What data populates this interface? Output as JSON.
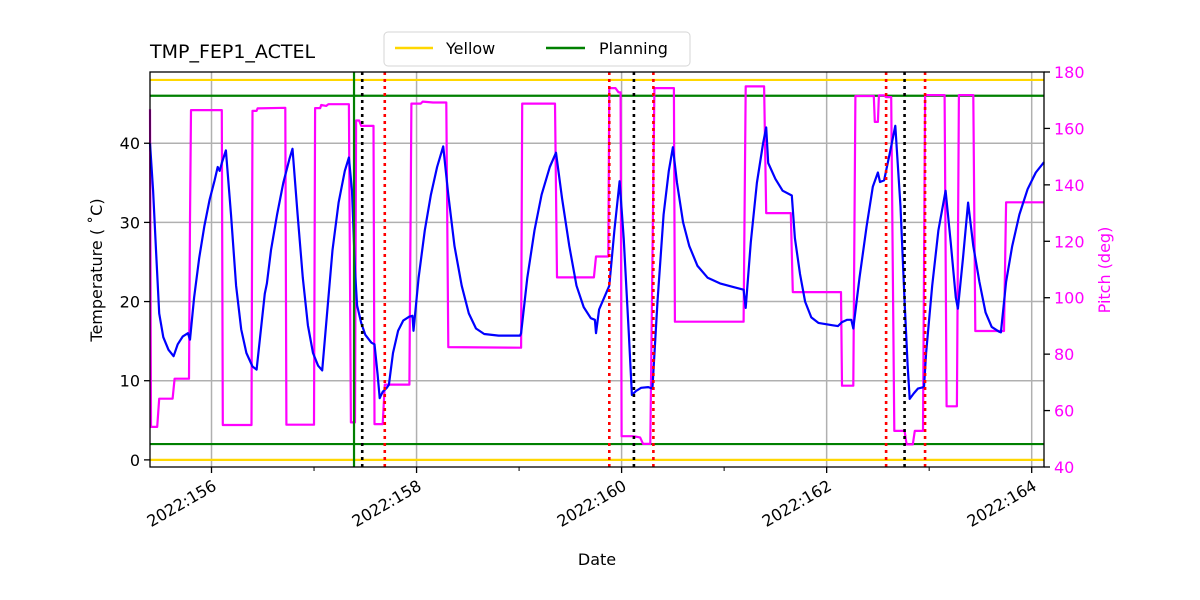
{
  "chart_data": {
    "type": "line",
    "title": "TMP_FEP1_ACTEL",
    "xlabel": "Date",
    "ylabel": "Temperature ($^\\circ$C)",
    "ylabel_display": "Temperature ( ˚C)",
    "y2label": "Pitch (deg)",
    "xlim": [
      155.4,
      164.12
    ],
    "ylim": [
      -0.9,
      49
    ],
    "y2lim": [
      40,
      180
    ],
    "x_ticks": [
      156,
      158,
      160,
      162,
      164
    ],
    "x_tick_labels": [
      "2022:156",
      "2022:158",
      "2022:160",
      "2022:162",
      "2022:164"
    ],
    "x_minor_ticks": [
      157,
      159,
      161,
      163
    ],
    "y_ticks": [
      0,
      10,
      20,
      30,
      40
    ],
    "y_tick_labels": [
      "0",
      "10",
      "20",
      "30",
      "40"
    ],
    "y2_ticks": [
      40,
      60,
      80,
      100,
      120,
      140,
      160,
      180
    ],
    "y2_tick_labels": [
      "40",
      "60",
      "80",
      "100",
      "120",
      "140",
      "160",
      "180"
    ],
    "grid": true,
    "legend": {
      "placement": "top-center",
      "entries": [
        {
          "label": "Yellow",
          "color": "#ffd700"
        },
        {
          "label": "Planning",
          "color": "#008000"
        }
      ]
    },
    "colors": {
      "temperature": "#0000ff",
      "pitch": "#ff00ff",
      "yellow": "#ffd700",
      "planning": "#008000",
      "grid": "#b0b0b0",
      "pitch_axis": "#ff00ff",
      "marker_black": "#000000",
      "marker_red": "#ff0000",
      "now_line": "#008000"
    },
    "hlines": [
      {
        "name": "yellow-high",
        "y": 48,
        "color": "#ffd700",
        "axis": "temperature"
      },
      {
        "name": "planning-high",
        "y": 46,
        "color": "#008000",
        "axis": "temperature"
      },
      {
        "name": "planning-low",
        "y": 2,
        "color": "#008000",
        "axis": "temperature"
      },
      {
        "name": "yellow-low",
        "y": 0,
        "color": "#ffd700",
        "axis": "temperature"
      }
    ],
    "vlines": [
      {
        "name": "now-line",
        "x": 157.39,
        "style": "solid",
        "color": "#008000"
      },
      {
        "name": "black-marker-1",
        "x": 157.47,
        "style": "dotted",
        "color": "#000000"
      },
      {
        "name": "red-marker-1",
        "x": 157.69,
        "style": "dotted",
        "color": "#ff0000"
      },
      {
        "name": "red-marker-2",
        "x": 159.88,
        "style": "dotted",
        "color": "#ff0000"
      },
      {
        "name": "black-marker-2",
        "x": 160.12,
        "style": "dotted",
        "color": "#000000"
      },
      {
        "name": "red-marker-3",
        "x": 160.31,
        "style": "dotted",
        "color": "#ff0000"
      },
      {
        "name": "red-marker-4",
        "x": 162.58,
        "style": "dotted",
        "color": "#ff0000"
      },
      {
        "name": "black-marker-3",
        "x": 162.76,
        "style": "dotted",
        "color": "#000000"
      },
      {
        "name": "red-marker-5",
        "x": 162.96,
        "style": "dotted",
        "color": "#ff0000"
      }
    ],
    "series": [
      {
        "name": "Temperature",
        "axis": "temperature",
        "color": "#0000ff",
        "points": [
          [
            155.4,
            40.0
          ],
          [
            155.43,
            34.0
          ],
          [
            155.46,
            26.0
          ],
          [
            155.49,
            18.5
          ],
          [
            155.53,
            15.5
          ],
          [
            155.58,
            13.9
          ],
          [
            155.63,
            13.1
          ],
          [
            155.67,
            14.6
          ],
          [
            155.72,
            15.6
          ],
          [
            155.77,
            16.0
          ],
          [
            155.79,
            15.2
          ],
          [
            155.83,
            20.5
          ],
          [
            155.88,
            25.5
          ],
          [
            155.93,
            29.5
          ],
          [
            155.98,
            32.8
          ],
          [
            156.03,
            35.3
          ],
          [
            156.06,
            37.0
          ],
          [
            156.08,
            36.5
          ],
          [
            156.1,
            37.5
          ],
          [
            156.14,
            39.1
          ],
          [
            156.19,
            31.0
          ],
          [
            156.24,
            22.0
          ],
          [
            156.29,
            16.5
          ],
          [
            156.34,
            13.5
          ],
          [
            156.4,
            11.8
          ],
          [
            156.44,
            11.4
          ],
          [
            156.49,
            17.5
          ],
          [
            156.52,
            21.0
          ],
          [
            156.54,
            22.3
          ],
          [
            156.58,
            26.5
          ],
          [
            156.64,
            31.0
          ],
          [
            156.7,
            35.0
          ],
          [
            156.76,
            38.0
          ],
          [
            156.79,
            39.3
          ],
          [
            156.84,
            31.0
          ],
          [
            156.89,
            23.0
          ],
          [
            156.94,
            17.0
          ],
          [
            156.99,
            13.5
          ],
          [
            157.04,
            11.9
          ],
          [
            157.08,
            11.3
          ],
          [
            157.13,
            19.0
          ],
          [
            157.18,
            26.5
          ],
          [
            157.24,
            32.5
          ],
          [
            157.3,
            36.5
          ],
          [
            157.34,
            38.2
          ],
          [
            157.37,
            34.0
          ],
          [
            157.4,
            24.0
          ],
          [
            157.42,
            19.5
          ],
          [
            157.46,
            17.3
          ],
          [
            157.5,
            15.8
          ],
          [
            157.56,
            14.8
          ],
          [
            157.59,
            14.6
          ],
          [
            157.62,
            10.8
          ],
          [
            157.64,
            7.8
          ],
          [
            157.67,
            8.6
          ],
          [
            157.71,
            9.1
          ],
          [
            157.73,
            9.5
          ],
          [
            157.77,
            13.5
          ],
          [
            157.82,
            16.3
          ],
          [
            157.87,
            17.6
          ],
          [
            157.93,
            18.1
          ],
          [
            157.96,
            18.2
          ],
          [
            157.97,
            16.3
          ],
          [
            158.02,
            23.0
          ],
          [
            158.08,
            29.0
          ],
          [
            158.14,
            33.5
          ],
          [
            158.2,
            37.0
          ],
          [
            158.26,
            39.6
          ],
          [
            158.31,
            33.5
          ],
          [
            158.37,
            27.0
          ],
          [
            158.44,
            22.0
          ],
          [
            158.51,
            18.5
          ],
          [
            158.58,
            16.6
          ],
          [
            158.66,
            15.9
          ],
          [
            158.8,
            15.7
          ],
          [
            159.01,
            15.7
          ],
          [
            159.02,
            16.0
          ],
          [
            159.08,
            23.0
          ],
          [
            159.15,
            29.0
          ],
          [
            159.22,
            33.5
          ],
          [
            159.3,
            37.0
          ],
          [
            159.36,
            38.8
          ],
          [
            159.42,
            33.0
          ],
          [
            159.49,
            27.0
          ],
          [
            159.56,
            22.0
          ],
          [
            159.63,
            19.3
          ],
          [
            159.7,
            17.9
          ],
          [
            159.74,
            17.7
          ],
          [
            159.75,
            16.0
          ],
          [
            159.78,
            19.0
          ],
          [
            159.83,
            20.5
          ],
          [
            159.88,
            22.0
          ],
          [
            159.93,
            29.0
          ],
          [
            159.98,
            35.2
          ],
          [
            160.02,
            28.0
          ],
          [
            160.07,
            16.0
          ],
          [
            160.1,
            8.2
          ],
          [
            160.14,
            8.7
          ],
          [
            160.19,
            9.1
          ],
          [
            160.26,
            9.2
          ],
          [
            160.3,
            9.0
          ],
          [
            160.35,
            20.0
          ],
          [
            160.41,
            31.0
          ],
          [
            160.46,
            36.5
          ],
          [
            160.5,
            39.5
          ],
          [
            160.54,
            35.0
          ],
          [
            160.6,
            30.0
          ],
          [
            160.66,
            27.0
          ],
          [
            160.74,
            24.5
          ],
          [
            160.84,
            23.0
          ],
          [
            160.96,
            22.3
          ],
          [
            161.1,
            21.8
          ],
          [
            161.19,
            21.5
          ],
          [
            161.21,
            19.2
          ],
          [
            161.26,
            27.5
          ],
          [
            161.32,
            35.0
          ],
          [
            161.38,
            40.0
          ],
          [
            161.41,
            42.0
          ],
          [
            161.43,
            37.5
          ],
          [
            161.5,
            35.5
          ],
          [
            161.57,
            34.0
          ],
          [
            161.66,
            33.4
          ],
          [
            161.69,
            28.0
          ],
          [
            161.74,
            23.5
          ],
          [
            161.79,
            20.0
          ],
          [
            161.85,
            18.0
          ],
          [
            161.92,
            17.3
          ],
          [
            162.06,
            17.0
          ],
          [
            162.11,
            16.9
          ],
          [
            162.15,
            17.4
          ],
          [
            162.2,
            17.7
          ],
          [
            162.24,
            17.7
          ],
          [
            162.26,
            16.6
          ],
          [
            162.32,
            23.0
          ],
          [
            162.39,
            29.5
          ],
          [
            162.45,
            34.5
          ],
          [
            162.5,
            36.3
          ],
          [
            162.52,
            35.1
          ],
          [
            162.56,
            35.3
          ],
          [
            162.62,
            39.0
          ],
          [
            162.67,
            42.2
          ],
          [
            162.72,
            32.0
          ],
          [
            162.76,
            20.0
          ],
          [
            162.79,
            12.0
          ],
          [
            162.81,
            7.7
          ],
          [
            162.85,
            8.4
          ],
          [
            162.89,
            9.0
          ],
          [
            162.95,
            9.2
          ],
          [
            162.97,
            13.5
          ],
          [
            163.03,
            22.0
          ],
          [
            163.09,
            29.0
          ],
          [
            163.16,
            34.0
          ],
          [
            163.21,
            27.5
          ],
          [
            163.26,
            20.5
          ],
          [
            163.28,
            19.1
          ],
          [
            163.33,
            25.5
          ],
          [
            163.38,
            32.5
          ],
          [
            163.43,
            27.0
          ],
          [
            163.49,
            22.5
          ],
          [
            163.55,
            18.6
          ],
          [
            163.61,
            16.8
          ],
          [
            163.68,
            16.2
          ],
          [
            163.7,
            16.1
          ],
          [
            163.75,
            22.5
          ],
          [
            163.81,
            27.0
          ],
          [
            163.88,
            31.0
          ],
          [
            163.96,
            34.2
          ],
          [
            164.04,
            36.3
          ],
          [
            164.12,
            37.6
          ]
        ]
      },
      {
        "name": "Pitch",
        "axis": "pitch",
        "color": "#ff00ff",
        "points": [
          [
            155.4,
            166.8
          ],
          [
            155.41,
            54.2
          ],
          [
            155.47,
            54.2
          ],
          [
            155.49,
            64.2
          ],
          [
            155.62,
            64.2
          ],
          [
            155.64,
            71.3
          ],
          [
            155.78,
            71.3
          ],
          [
            155.79,
            127.5
          ],
          [
            155.8,
            166.5
          ],
          [
            156.1,
            166.5
          ],
          [
            156.11,
            54.9
          ],
          [
            156.39,
            54.9
          ],
          [
            156.4,
            166.2
          ],
          [
            156.44,
            166.2
          ],
          [
            156.45,
            167.1
          ],
          [
            156.72,
            167.3
          ],
          [
            156.73,
            55.0
          ],
          [
            157.0,
            55.0
          ],
          [
            157.01,
            167.2
          ],
          [
            157.06,
            167.2
          ],
          [
            157.07,
            168.3
          ],
          [
            157.12,
            168.0
          ],
          [
            157.14,
            168.6
          ],
          [
            157.34,
            168.6
          ],
          [
            157.36,
            55.8
          ],
          [
            157.4,
            55.8
          ],
          [
            157.41,
            162.8
          ],
          [
            157.44,
            162.8
          ],
          [
            157.46,
            160.9
          ],
          [
            157.58,
            160.9
          ],
          [
            157.59,
            55.2
          ],
          [
            157.67,
            55.2
          ],
          [
            157.69,
            69.2
          ],
          [
            157.93,
            69.2
          ],
          [
            157.95,
            168.8
          ],
          [
            158.04,
            168.8
          ],
          [
            158.06,
            169.5
          ],
          [
            158.16,
            169.2
          ],
          [
            158.29,
            169.2
          ],
          [
            158.31,
            82.5
          ],
          [
            159.02,
            82.3
          ],
          [
            159.03,
            168.8
          ],
          [
            159.35,
            168.8
          ],
          [
            159.37,
            107.2
          ],
          [
            159.73,
            107.2
          ],
          [
            159.75,
            114.6
          ],
          [
            159.87,
            114.6
          ],
          [
            159.88,
            174.3
          ],
          [
            159.94,
            174.3
          ],
          [
            159.97,
            172.8
          ],
          [
            159.99,
            172.8
          ],
          [
            160.0,
            50.9
          ],
          [
            160.11,
            50.9
          ],
          [
            160.18,
            50.5
          ],
          [
            160.21,
            48.2
          ],
          [
            160.28,
            48.2
          ],
          [
            160.32,
            174.3
          ],
          [
            160.51,
            174.3
          ],
          [
            160.52,
            91.5
          ],
          [
            161.19,
            91.5
          ],
          [
            161.21,
            174.9
          ],
          [
            161.39,
            174.9
          ],
          [
            161.41,
            130.0
          ],
          [
            161.65,
            130.0
          ],
          [
            161.67,
            102.0
          ],
          [
            162.14,
            102.0
          ],
          [
            162.15,
            68.8
          ],
          [
            162.26,
            68.8
          ],
          [
            162.28,
            171.5
          ],
          [
            162.44,
            171.5
          ],
          [
            162.46,
            171.5
          ],
          [
            162.47,
            162.3
          ],
          [
            162.5,
            162.3
          ],
          [
            162.51,
            171.7
          ],
          [
            162.56,
            171.7
          ],
          [
            162.58,
            171.1
          ],
          [
            162.63,
            171.1
          ],
          [
            162.66,
            52.8
          ],
          [
            162.76,
            52.8
          ],
          [
            162.78,
            48.0
          ],
          [
            162.84,
            48.0
          ],
          [
            162.86,
            52.8
          ],
          [
            162.94,
            52.8
          ],
          [
            162.96,
            171.8
          ],
          [
            163.15,
            171.8
          ],
          [
            163.17,
            61.5
          ],
          [
            163.27,
            61.5
          ],
          [
            163.29,
            171.8
          ],
          [
            163.43,
            171.8
          ],
          [
            163.45,
            88.2
          ],
          [
            163.73,
            88.2
          ],
          [
            163.75,
            133.8
          ],
          [
            164.12,
            133.8
          ]
        ]
      }
    ]
  }
}
